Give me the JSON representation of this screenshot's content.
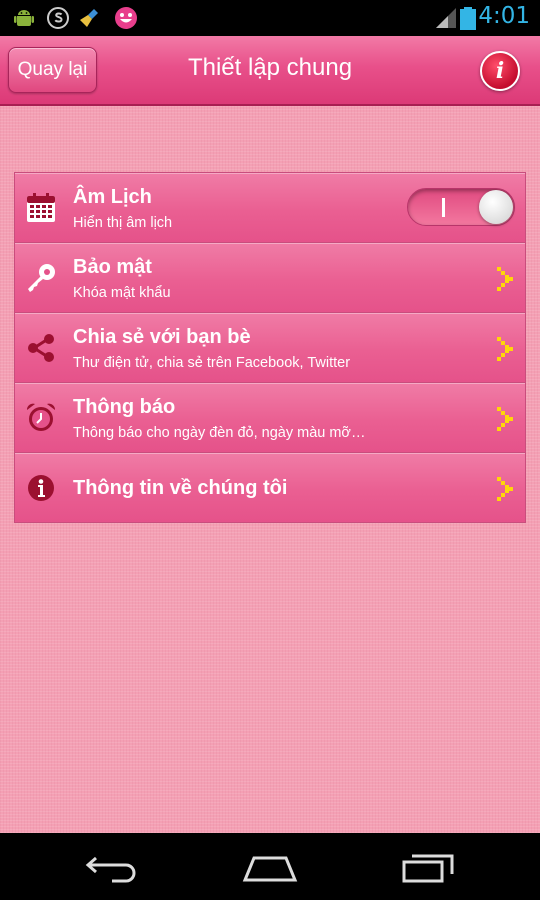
{
  "status_bar": {
    "time": "4:01",
    "time_color": "#33b5e5",
    "left_icons": [
      "android-debug-icon",
      "s-app-icon",
      "broom-icon",
      "smiley-icon"
    ],
    "right_icons": [
      "signal-icon",
      "battery-icon"
    ]
  },
  "header": {
    "back_label": "Quay lại",
    "title": "Thiết lập chung",
    "info_label": "i"
  },
  "settings": {
    "items": [
      {
        "icon": "calendar-icon",
        "title": "Âm Lịch",
        "subtitle": "Hiển thị âm lịch",
        "control": "toggle",
        "toggle_on": true
      },
      {
        "icon": "key-icon",
        "title": "Bảo mật",
        "subtitle": "Khóa mật khẩu",
        "control": "chevron"
      },
      {
        "icon": "share-icon",
        "title": "Chia sẻ với bạn bè",
        "subtitle": "Thư điện tử, chia sẻ trên Facebook, Twitter",
        "control": "chevron"
      },
      {
        "icon": "alarm-clock-icon",
        "title": "Thông báo",
        "subtitle": "Thông báo cho ngày đèn đỏ, ngày màu mỡ…",
        "control": "chevron"
      },
      {
        "icon": "info-circle-icon",
        "title": "Thông tin về chúng tôi",
        "control": "chevron"
      }
    ]
  },
  "nav_bar": {
    "buttons": [
      "back-nav-icon",
      "home-nav-icon",
      "recents-nav-icon"
    ]
  },
  "colors": {
    "header_pink": "#e8508a",
    "background_pink": "#f4a0b4",
    "row_pink": "#ea5f92",
    "icon_dark_red": "#9b1030",
    "chevron_yellow": "#ffd60a"
  }
}
